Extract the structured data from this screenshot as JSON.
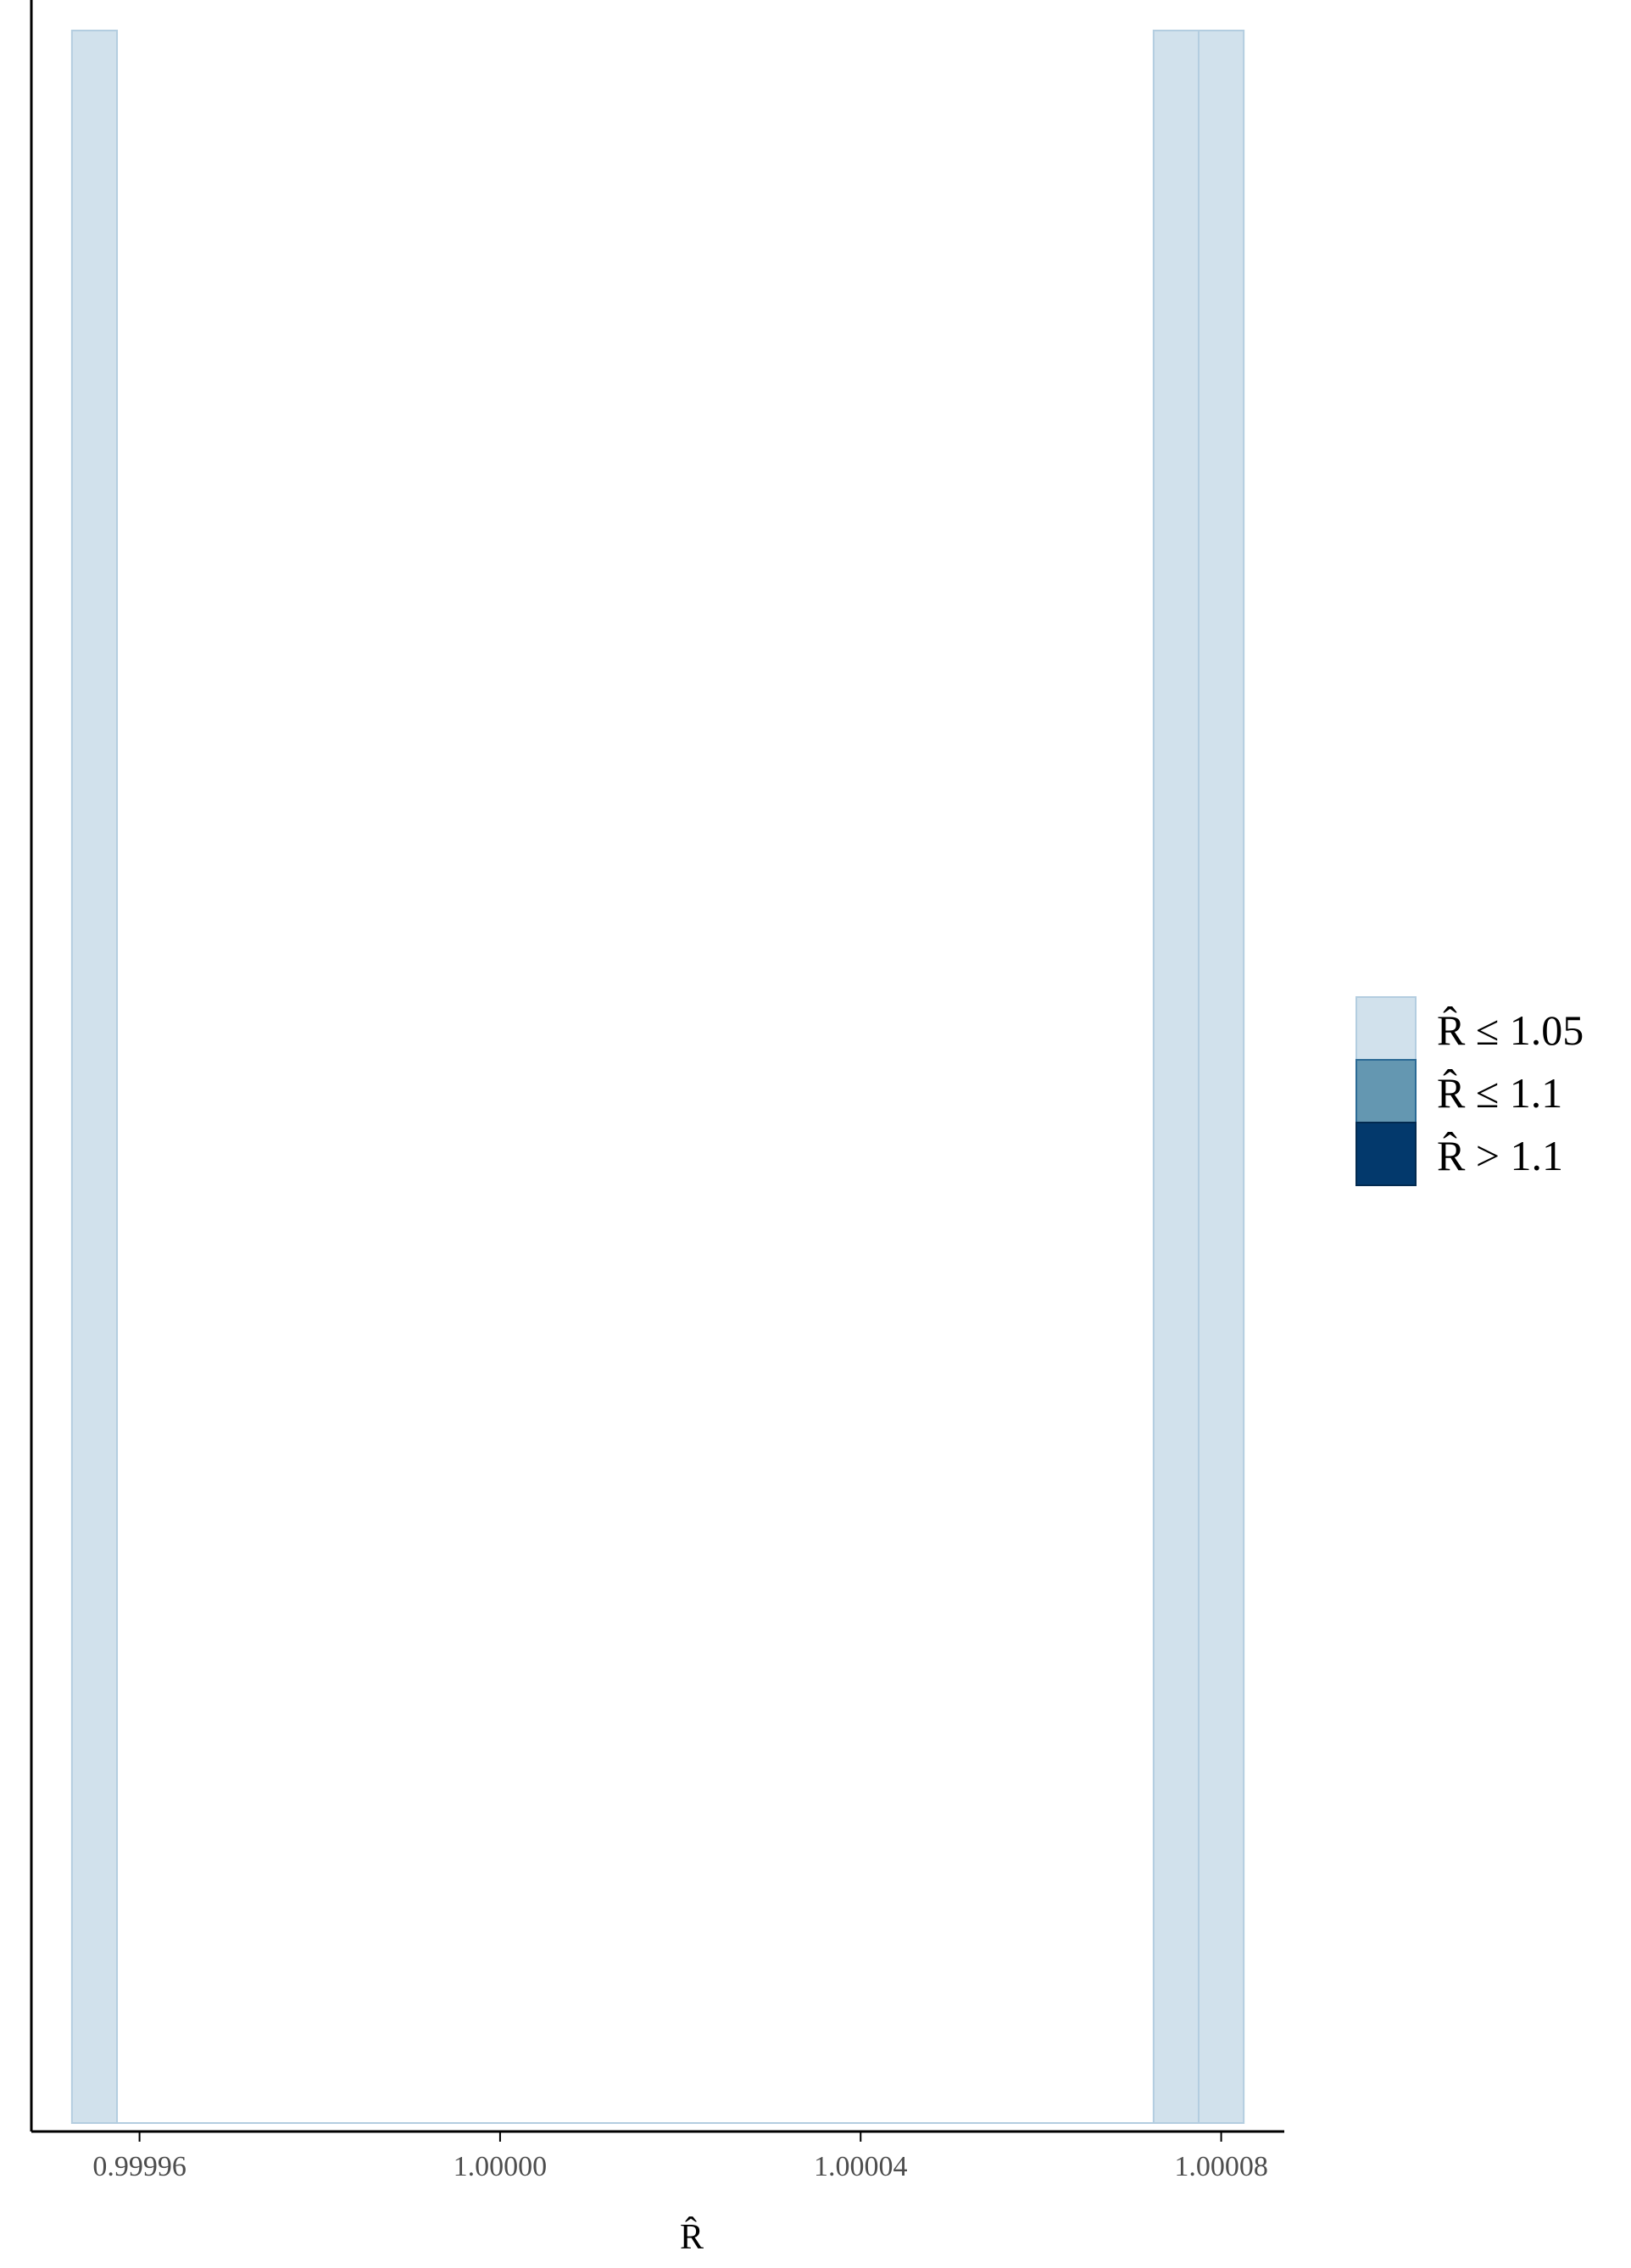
{
  "chart_data": {
    "type": "bar",
    "x": [
      0.999955,
      1.000075,
      1.00008
    ],
    "values": [
      1,
      1,
      1
    ],
    "bin_width": 5e-06,
    "series_category": [
      "R̂ ≤ 1.05",
      "R̂ ≤ 1.05",
      "R̂ ≤ 1.05"
    ],
    "xlim": [
      0.999948,
      1.000087
    ],
    "ylim": [
      0,
      1
    ],
    "xticks": [
      0.99996,
      1.0,
      1.00004,
      1.00008
    ],
    "xtick_labels": [
      "0.99996",
      "1.00000",
      "1.00004",
      "1.00008"
    ],
    "xlabel": "R̂",
    "ylabel": "",
    "title": "",
    "grid": false,
    "legend": {
      "position": "right",
      "entries": [
        {
          "label": "R̂ ≤ 1.05",
          "color": "#d1e1ec"
        },
        {
          "label": "R̂ ≤ 1.1",
          "color": "#6497b1"
        },
        {
          "label": "R̂ > 1.1",
          "color": "#03396c"
        }
      ]
    }
  },
  "colors": {
    "bar_fill": "#d1e1ec",
    "bar_stroke": "#b3cde0",
    "axis": "#000000"
  }
}
